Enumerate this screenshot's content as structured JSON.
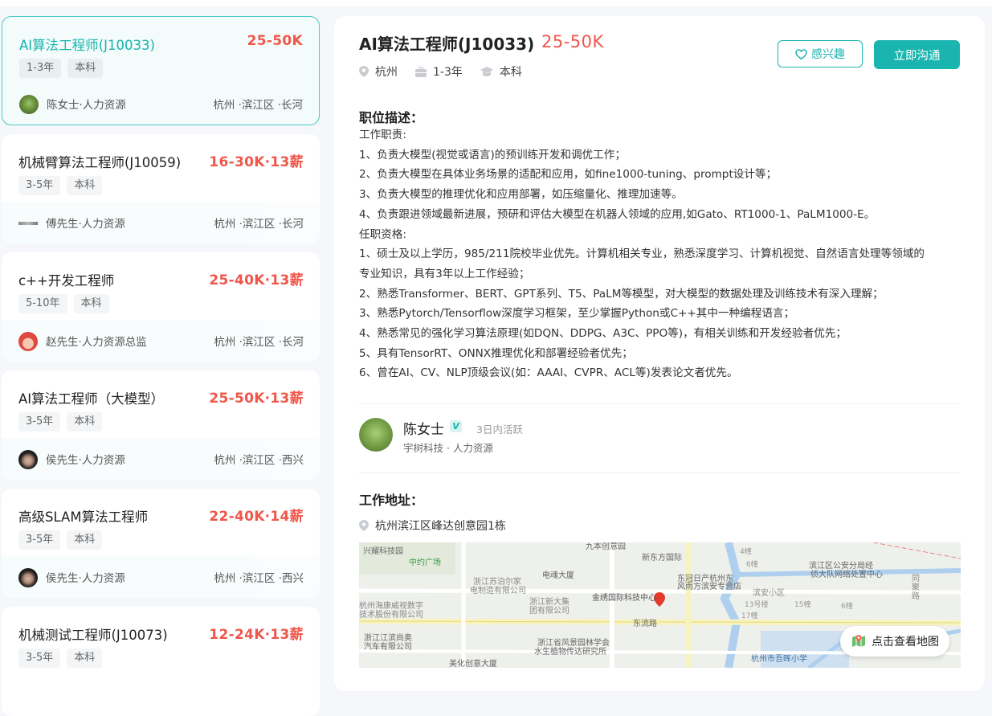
{
  "jobs": [
    {
      "title": "AI算法工程师(J10033)",
      "salary": "25-50K",
      "tags": [
        "1-3年",
        "本科"
      ],
      "recruiter": "陈女士·人力资源",
      "location": "杭州 ·滨江区 ·长河",
      "active": true
    },
    {
      "title": "机械臂算法工程师(J10059)",
      "salary": "16-30K·13薪",
      "tags": [
        "3-5年",
        "本科"
      ],
      "recruiter": "傅先生·人力资源",
      "location": "杭州 ·滨江区 ·长河"
    },
    {
      "title": "c++开发工程师",
      "salary": "25-40K·13薪",
      "tags": [
        "5-10年",
        "本科"
      ],
      "recruiter": "赵先生·人力资源总监",
      "location": "杭州 ·滨江区 ·长河"
    },
    {
      "title": "AI算法工程师（大模型）",
      "salary": "25-50K·13薪",
      "tags": [
        "3-5年",
        "本科"
      ],
      "recruiter": "侯先生·人力资源",
      "location": "杭州 ·滨江区 ·西兴"
    },
    {
      "title": "高级SLAM算法工程师",
      "salary": "22-40K·14薪",
      "tags": [
        "3-5年",
        "本科"
      ],
      "recruiter": "侯先生·人力资源",
      "location": "杭州 ·滨江区 ·西兴"
    },
    {
      "title": "机械测试工程师(J10073)",
      "salary": "12-24K·13薪",
      "tags": [
        "3-5年",
        "本科"
      ],
      "recruiter": "",
      "location": ""
    }
  ],
  "detail": {
    "title": "AI算法工程师(J10033)",
    "salary": "25-50K",
    "city": "杭州",
    "experience": "1-3年",
    "degree": "本科",
    "interest_label": "感兴趣",
    "chat_label": "立即沟通",
    "desc_heading": "职位描述：",
    "desc_lines": [
      "工作职责:",
      "1、负责大模型(视觉或语言)的预训练开发和调优工作；",
      "2、负责大模型在具体业务场景的适配和应用，如fine1000-tuning、prompt设计等；",
      "3、负责大模型的推理优化和应用部署，如压缩量化、推理加速等。",
      "4、负责跟进领域最新进展，预研和评估大模型在机器人领域的应用,如Gato、RT1000-1、PaLM1000-E。",
      "任职资格:",
      "1、硕士及以上学历，985/211院校毕业优先。计算机相关专业，熟悉深度学习、计算机视觉、自然语言处理等领域的",
      "专业知识，具有3年以上工作经验；",
      "2、熟悉Transformer、BERT、GPT系列、T5、PaLM等模型，对大模型的数据处理及训练技术有深入理解；",
      "3、熟悉Pytorch/Tensorflow深度学习框架，至少掌握Python或C++其中一种编程语言；",
      "4、熟悉常见的强化学习算法原理(如DQN、DDPG、A3C、PPO等)，有相关训练和开发经验者优先；",
      "5、具有TensorRT、ONNX推理优化和部署经验者优先；",
      "6、曾在AI、CV、NLP顶级会议(如：AAAI、CVPR、ACL等)发表论文者优先。"
    ],
    "boss_name": "陈女士",
    "boss_active": "3日内活跃",
    "boss_company": "宇树科技 · 人力资源",
    "address_heading": "工作地址：",
    "address": "杭州滨江区峰达创意园1栋",
    "map_button": "点击查看地图",
    "map_labels": [
      "兴耀科技园",
      "中约广场",
      "九本创意园",
      "新东方国际",
      "电魂大厦",
      "东冠日产杭州东",
      "风雨方滨安专营店",
      "滨江区公安分局经",
      "侦大队网络处置中心",
      "浙江苏泊尔家",
      "电制造有限公司",
      "浙江新大集",
      "团有限公司",
      "金绣国际科技中心",
      "滨安小区",
      "杭州海康威视数字",
      "技术股份有限公司",
      "东流路",
      "浙江江滨尚奥",
      "汽车有限公司",
      "浙江省风景园林学会",
      "水生植物传达研究所",
      "美化创意大厦",
      "杭州市吾晖小学",
      "同",
      "聚",
      "路",
      "4幢",
      "6幢",
      "13号楼",
      "15幢",
      "6幢",
      "17幢"
    ]
  },
  "colors": {
    "accent": "#19b5ae",
    "salary": "#f0564a"
  }
}
